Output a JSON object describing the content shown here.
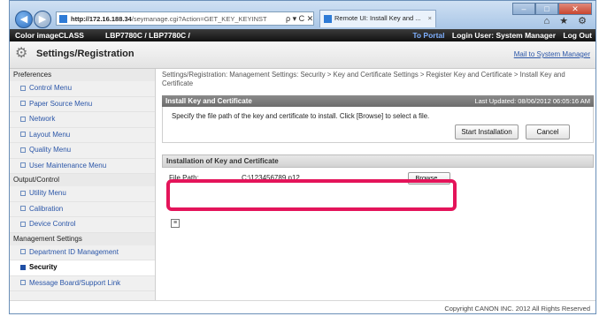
{
  "browser": {
    "address_host": "http://172.16.188.34",
    "address_path": "/seymanage.cgi?Action=GET_KEY_KEYINST",
    "address_buttons": "ρ ▾ C ✕",
    "tab_title": "Remote UI: Install Key and ...",
    "tab_close": "×",
    "window_minimize": "–",
    "window_maximize": "□",
    "window_close": "✕",
    "toolbar_icons": "⌂ ★ ⚙"
  },
  "appbar": {
    "brand": "Color imageCLASS",
    "model": "LBP7780C / LBP7780C /",
    "to_portal": "To Portal",
    "login_user": "Login User: System Manager",
    "log_out": "Log Out"
  },
  "titlebar": {
    "title": "Settings/Registration",
    "mail_link": "Mail to System Manager"
  },
  "sidebar": {
    "sections": [
      {
        "label": "Preferences",
        "items": [
          "Control Menu",
          "Paper Source Menu",
          "Network",
          "Layout Menu",
          "Quality Menu",
          "User Maintenance Menu"
        ]
      },
      {
        "label": "Output/Control",
        "items": [
          "Utility Menu",
          "Calibration",
          "Device Control"
        ]
      },
      {
        "label": "Management Settings",
        "items": [
          "Department ID Management",
          "Security",
          "Message Board/Support Link"
        ]
      }
    ],
    "active_item": "Security"
  },
  "main": {
    "breadcrumb": "Settings/Registration: Management Settings: Security > Key and Certificate Settings > Register Key and Certificate > Install Key and Certificate",
    "panel_title": "Install Key and Certificate",
    "last_updated": "Last Updated: 08/06/2012 06:05:16 AM",
    "instruction": "Specify the file path of the key and certificate to install. Click [Browse] to select a file.",
    "start_button": "Start Installation",
    "cancel_button": "Cancel",
    "sub_title": "Installation of Key and Certificate",
    "file_path_label": "File Path:",
    "file_path_value": "C:\\123456789.p12",
    "browse_button": "Browse...",
    "toggle_symbol": "≡"
  },
  "footer": {
    "copyright": "Copyright CANON INC. 2012 All Rights Reserved"
  },
  "colors": {
    "highlight": "#e4145a",
    "link": "#2b56a8",
    "header_dark": "#111111"
  }
}
